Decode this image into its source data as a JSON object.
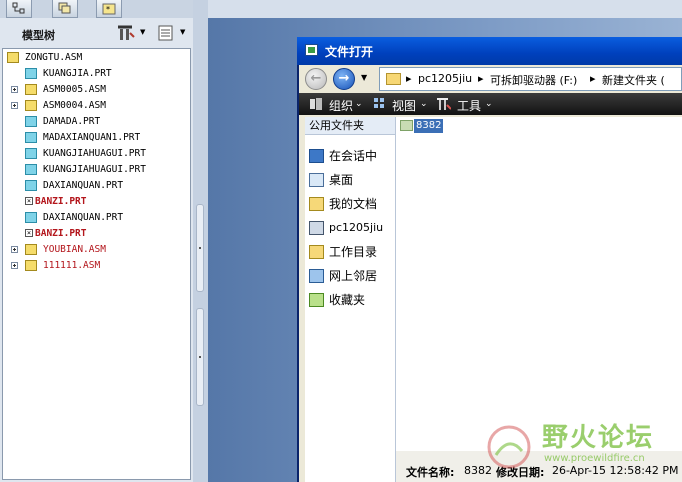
{
  "model_panel": {
    "title": "模型树",
    "tabs": [
      "model-tree-tab",
      "layer-tab",
      "favorites-tab"
    ],
    "tree": [
      {
        "label": "ZONGTU.ASM",
        "type": "asm",
        "expand": false,
        "color": "normal"
      },
      {
        "label": "KUANGJIA.PRT",
        "type": "prt",
        "expand": false,
        "color": "normal"
      },
      {
        "label": "ASM0005.ASM",
        "type": "asm",
        "expand": true,
        "color": "normal"
      },
      {
        "label": "ASM0004.ASM",
        "type": "asm",
        "expand": true,
        "color": "normal"
      },
      {
        "label": "DAMADA.PRT",
        "type": "prt",
        "expand": false,
        "color": "normal"
      },
      {
        "label": "MADAXIANQUAN1.PRT",
        "type": "prt",
        "expand": false,
        "color": "normal"
      },
      {
        "label": "KUANGJIAHUAGUI.PRT",
        "type": "prt",
        "expand": false,
        "color": "normal"
      },
      {
        "label": "KUANGJIAHUAGUI.PRT",
        "type": "prt",
        "expand": false,
        "color": "normal"
      },
      {
        "label": "DAXIANQUAN.PRT",
        "type": "prt",
        "expand": false,
        "color": "normal"
      },
      {
        "label": "BANZI.PRT",
        "type": "prt",
        "expand": false,
        "color": "red-bold"
      },
      {
        "label": "DAXIANQUAN.PRT",
        "type": "prt",
        "expand": false,
        "color": "normal"
      },
      {
        "label": "BANZI.PRT",
        "type": "prt",
        "expand": false,
        "color": "red-bold"
      },
      {
        "label": "YOUBIAN.ASM",
        "type": "asm",
        "expand": true,
        "color": "red"
      },
      {
        "label": "111111.ASM",
        "type": "asm",
        "expand": true,
        "color": "red"
      }
    ]
  },
  "dialog": {
    "title": "文件打开",
    "path": [
      "pc1205jiu",
      "可拆卸驱动器 (F:)",
      "新建文件夹 ("
    ],
    "commands": {
      "organize": "组织",
      "views": "视图",
      "tools": "工具"
    },
    "nav_header": "公用文件夹",
    "nav_items": [
      {
        "label": "在会话中",
        "icon": "session-icon"
      },
      {
        "label": "桌面",
        "icon": "desktop-icon"
      },
      {
        "label": "我的文档",
        "icon": "my-documents-icon"
      },
      {
        "label": "pc1205jiu",
        "icon": "computer-icon"
      },
      {
        "label": "工作目录",
        "icon": "working-directory-icon"
      },
      {
        "label": "网上邻居",
        "icon": "network-icon"
      },
      {
        "label": "收藏夹",
        "icon": "favorites-icon"
      }
    ],
    "folder": "8382",
    "details": {
      "name_label": "文件名称:",
      "name_value": "8382",
      "date_label": "修改日期:",
      "date_value": "26-Apr-15 12:58:42 PM"
    }
  },
  "watermark": {
    "text": "野火论坛",
    "url": "www.proewildfire.cn"
  },
  "colors": {
    "title_bar": "#0a5ee0",
    "red_item": "#b3151b",
    "selection": "#3b6fb6"
  }
}
